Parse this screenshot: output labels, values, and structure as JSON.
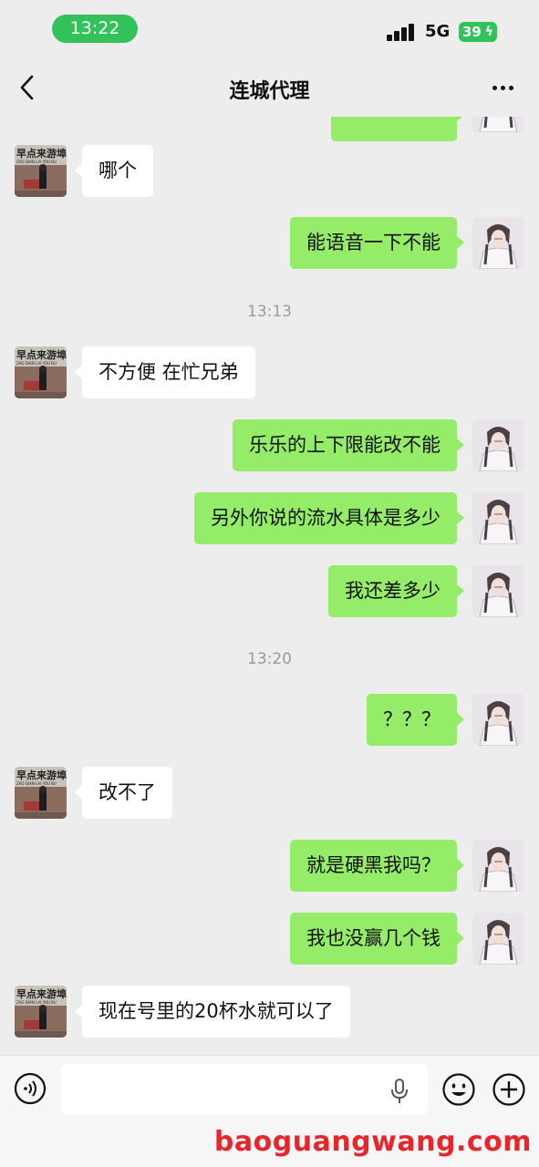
{
  "status_bar": {
    "time": "13:22",
    "network": "5G",
    "battery": "39"
  },
  "header": {
    "title": "连城代理"
  },
  "messages": [
    {
      "from": "other",
      "text": "哪个"
    },
    {
      "from": "me",
      "text": "能语音一下不能"
    },
    {
      "type": "time",
      "text": "13:13"
    },
    {
      "from": "other",
      "text": "不方便 在忙兄弟"
    },
    {
      "from": "me",
      "text": "乐乐的上下限能改不能"
    },
    {
      "from": "me",
      "text": "另外你说的流水具体是多少"
    },
    {
      "from": "me",
      "text": "我还差多少"
    },
    {
      "type": "time",
      "text": "13:20"
    },
    {
      "from": "me",
      "text": "？？？"
    },
    {
      "from": "other",
      "text": "改不了"
    },
    {
      "from": "me",
      "text": "就是硬黑我吗？"
    },
    {
      "from": "me",
      "text": "我也没赢几个钱"
    },
    {
      "from": "other",
      "text": "现在号里的20杯水就可以了"
    }
  ],
  "other_avatar_sign": "早点来游埠",
  "other_avatar_sign_sub": "ZAO DIAN LAI YOU BU",
  "input_bar": {
    "placeholder": ""
  },
  "watermark": "baoguangwang.com",
  "colors": {
    "out_bubble": "#95ec69",
    "in_bubble": "#ffffff",
    "background": "#ededed",
    "status_green": "#33c15a",
    "watermark_red": "#e8252a"
  }
}
